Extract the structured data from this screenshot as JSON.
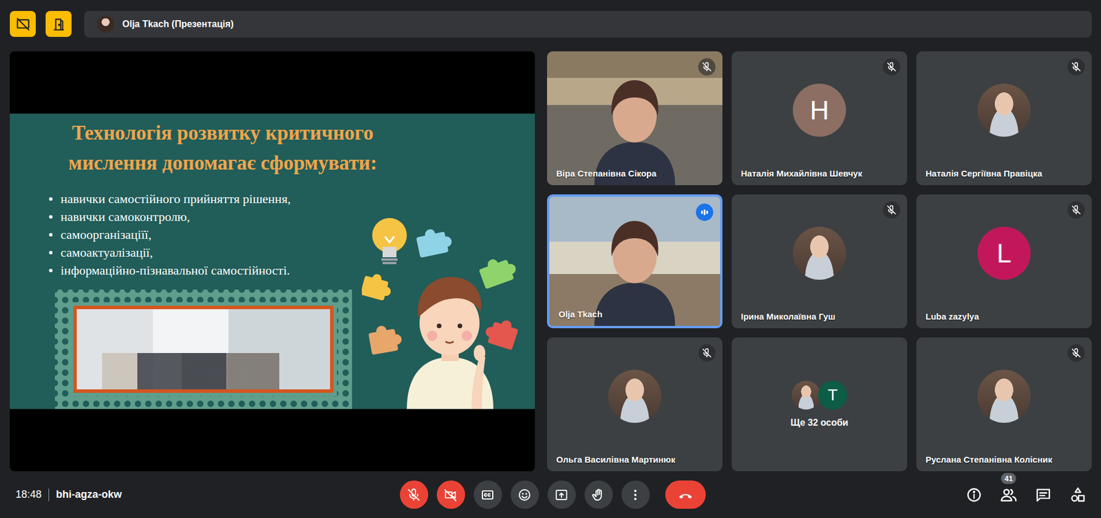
{
  "top_bar": {
    "presenter": "Olja Tkach (Презентація)"
  },
  "slide": {
    "title_lines": [
      "Технологія розвитку критичного",
      "мислення допомагає сформувати:"
    ],
    "bullets": [
      "навички самостійного прийняття рішення,",
      "навички самоконтролю,",
      "самоорганізаціїї,",
      "самоактуалізації,",
      "інформаційно-пізнавальної самостійності."
    ]
  },
  "tiles": [
    {
      "name": "Віра Степанівна Сікора",
      "kind": "video",
      "muted": true,
      "speaking": false
    },
    {
      "name": "Наталія Михайлівна Шевчук",
      "kind": "letter",
      "letter": "Н",
      "color": "#8d6e63",
      "muted": true,
      "speaking": false
    },
    {
      "name": "Наталія Сергіївна Правіцка",
      "kind": "photo",
      "muted": true,
      "speaking": false
    },
    {
      "name": "Olja Tkach",
      "kind": "video",
      "muted": false,
      "speaking": true
    },
    {
      "name": "Ірина Миколаївна Гуш",
      "kind": "photo",
      "muted": true,
      "speaking": false
    },
    {
      "name": "Luba zazylya",
      "kind": "letter",
      "letter": "L",
      "color": "#c2185b",
      "muted": true,
      "speaking": false
    },
    {
      "name": "Ольга Василівна Мартинюк",
      "kind": "photo",
      "muted": true,
      "speaking": false
    },
    {
      "name": "Ще 32 особи",
      "kind": "group",
      "muted": false,
      "speaking": false,
      "avatars": [
        {
          "kind": "photo"
        },
        {
          "kind": "letter",
          "letter": "T",
          "color": "#0d5c46"
        }
      ]
    },
    {
      "name": "Руслана Степанівна Колісник",
      "kind": "photo",
      "muted": true,
      "speaking": false
    }
  ],
  "bottom_bar": {
    "time": "18:48",
    "meeting_code": "bhi-agza-okw",
    "mic_on": false,
    "camera_on": false,
    "people_count": "41"
  }
}
